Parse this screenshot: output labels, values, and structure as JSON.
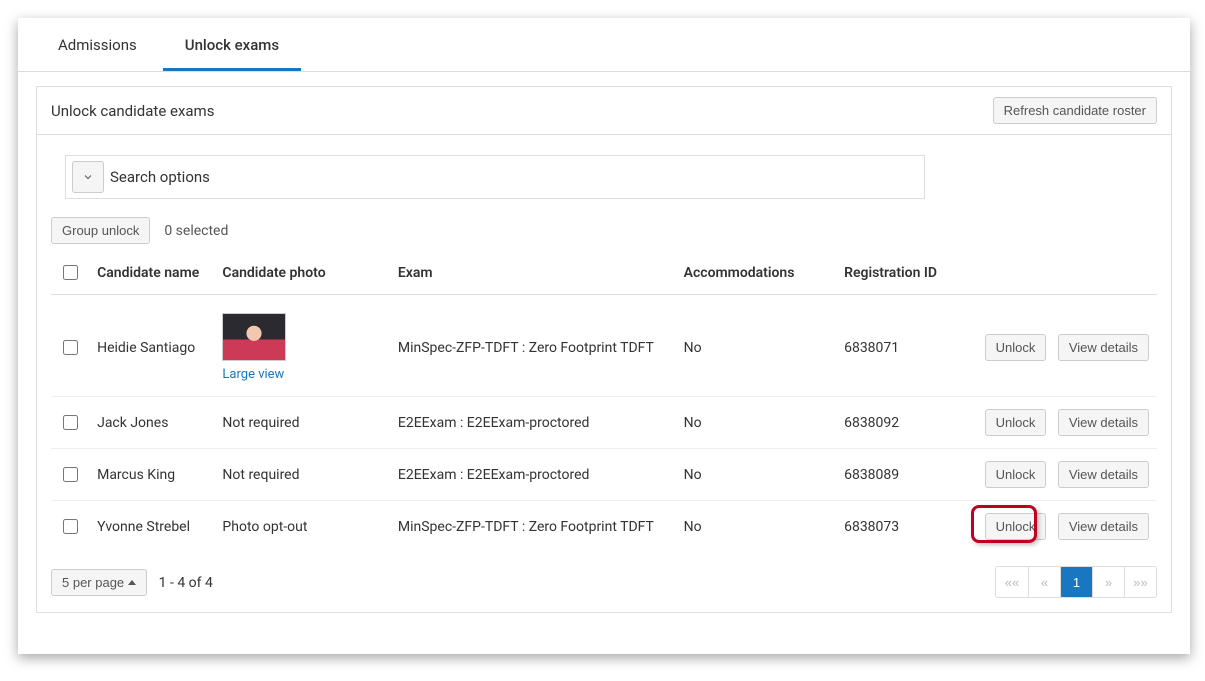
{
  "tabs": [
    {
      "label": "Admissions",
      "active": false
    },
    {
      "label": "Unlock exams",
      "active": true
    }
  ],
  "panel": {
    "title": "Unlock candidate exams",
    "refresh_label": "Refresh candidate roster",
    "search_label": "Search options",
    "group_unlock_label": "Group unlock",
    "selected_text": "0 selected"
  },
  "columns": {
    "name": "Candidate name",
    "photo": "Candidate photo",
    "exam": "Exam",
    "accommodations": "Accommodations",
    "registration_id": "Registration ID"
  },
  "action_labels": {
    "unlock": "Unlock",
    "view_details": "View details",
    "large_view": "Large view"
  },
  "rows": [
    {
      "name": "Heidie Santiago",
      "photo": "thumb",
      "exam": "MinSpec-ZFP-TDFT : Zero Footprint TDFT",
      "accommodations": "No",
      "registration_id": "6838071"
    },
    {
      "name": "Jack Jones",
      "photo_text": "Not required",
      "exam": "E2EExam : E2EExam-proctored",
      "accommodations": "No",
      "registration_id": "6838092"
    },
    {
      "name": "Marcus King",
      "photo_text": "Not required",
      "exam": "E2EExam : E2EExam-proctored",
      "accommodations": "No",
      "registration_id": "6838089"
    },
    {
      "name": "Yvonne Strebel",
      "photo_text": "Photo opt-out",
      "exam": "MinSpec-ZFP-TDFT : Zero Footprint TDFT",
      "accommodations": "No",
      "registration_id": "6838073",
      "highlight_unlock": true
    }
  ],
  "footer": {
    "per_page_label": "5 per page",
    "range_text": "1 - 4 of 4",
    "pager": {
      "first": "««",
      "prev": "«",
      "current": "1",
      "next": "»",
      "last": "»»"
    }
  }
}
